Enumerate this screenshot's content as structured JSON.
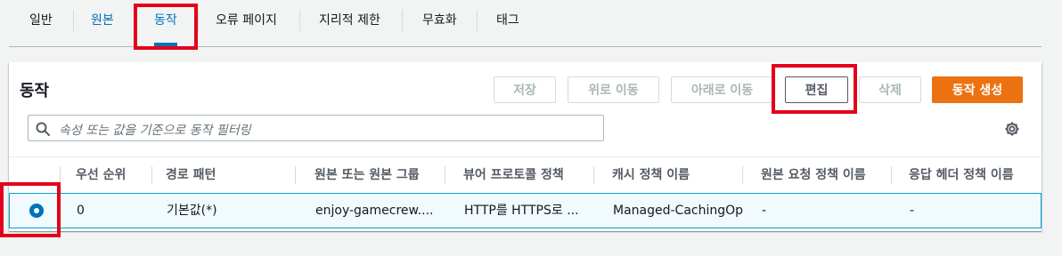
{
  "tabs": [
    {
      "label": "일반"
    },
    {
      "label": "원본"
    },
    {
      "label": "동작"
    },
    {
      "label": "오류 페이지"
    },
    {
      "label": "지리적 제한"
    },
    {
      "label": "무효화"
    },
    {
      "label": "태그"
    }
  ],
  "panel": {
    "title": "동작",
    "buttons": {
      "save": "저장",
      "move_up": "위로 이동",
      "move_down": "아래로 이동",
      "edit": "편집",
      "delete": "삭제",
      "create": "동작 생성"
    },
    "search_placeholder": "속성 또는 값을 기준으로 동작 필터링"
  },
  "table": {
    "columns": [
      "우선 순위",
      "경로 패턴",
      "원본 또는 원본 그룹",
      "뷰어 프로토콜 정책",
      "캐시 정책 이름",
      "원본 요청 정책 이름",
      "응답 헤더 정책 이름"
    ],
    "rows": [
      {
        "selected": true,
        "cells": [
          "0",
          "기본값(*)",
          "enjoy-gamecrew....",
          "HTTP를 HTTPS로 ...",
          "Managed-CachingOptir",
          "-",
          "-"
        ]
      }
    ]
  },
  "colors": {
    "accent": "#0073bb",
    "primary_button": "#ec7211",
    "highlight": "#e3001b"
  },
  "icons": [
    "search-icon",
    "gear-icon"
  ]
}
